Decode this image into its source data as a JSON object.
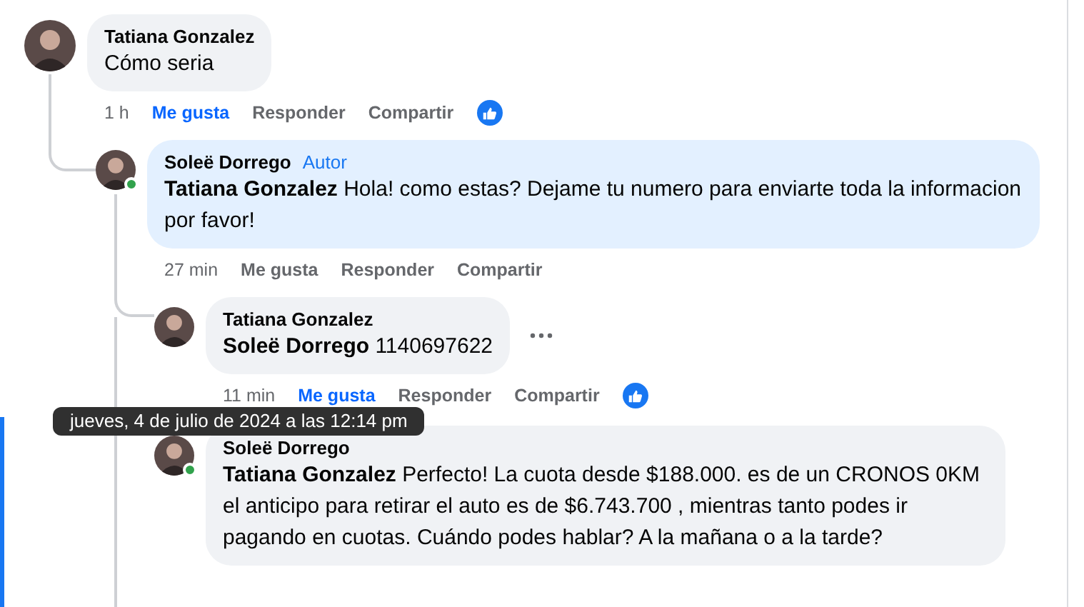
{
  "comments": [
    {
      "author": "Tatiana Gonzalez",
      "text": "Cómo seria",
      "highlighted": false,
      "online": false,
      "time": "1 h",
      "actions": [
        "Me gusta",
        "Responder",
        "Compartir"
      ],
      "liked": true,
      "reaction": true,
      "children": [
        {
          "author": "Soleë Dorrego",
          "badge": "Autor",
          "mention": "Tatiana Gonzalez",
          "text": "Hola! como estas? Dejame tu numero para enviarte toda la informacion por favor!",
          "highlighted": true,
          "online": true,
          "time": "27 min",
          "actions": [
            "Me gusta",
            "Responder",
            "Compartir"
          ],
          "liked": false,
          "reaction": false,
          "children": [
            {
              "author": "Tatiana Gonzalez",
              "mention": "Soleë Dorrego",
              "text": "1140697622",
              "highlighted": false,
              "online": false,
              "menu": true,
              "time": "11 min",
              "actions": [
                "Me gusta",
                "Responder",
                "Compartir"
              ],
              "liked": true,
              "reaction": true
            },
            {
              "author": "Soleë Dorrego",
              "mention": "Tatiana Gonzalez",
              "text": "Perfecto! La cuota desde $188.000. es de un CRONOS 0KM el anticipo para retirar el auto es de $6.743.700 , mientras tanto podes ir pagando en cuotas. Cuándo podes hablar? A la mañana o a la tarde?",
              "highlighted": false,
              "online": true
            }
          ]
        }
      ]
    }
  ],
  "tooltip": "jueves, 4 de julio de 2024 a las 12:14 pm"
}
